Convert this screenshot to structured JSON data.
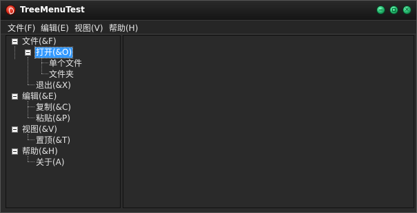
{
  "window": {
    "title": "TreeMenuTest"
  },
  "menubar": {
    "items": [
      "文件(F)",
      "编辑(E)",
      "视图(V)",
      "帮助(H)"
    ]
  },
  "tree": {
    "file": "文件(&F)",
    "open": "打开(&O)",
    "single_file": "单个文件",
    "folder": "文件夹",
    "exit": "退出(&X)",
    "edit": "编辑(&E)",
    "copy": "复制(&C)",
    "paste": "粘贴(&P)",
    "view": "视图(&V)",
    "top": "置顶(&T)",
    "help": "帮助(&H)",
    "about": "关于(A)"
  }
}
